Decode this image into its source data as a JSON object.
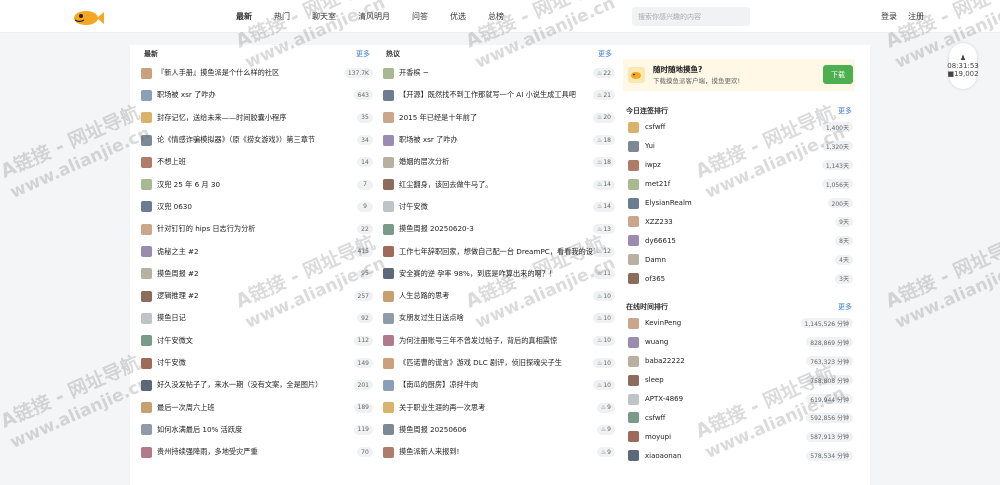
{
  "nav": [
    "最新",
    "热门",
    "聊天室",
    "清风明月",
    "问答",
    "优选",
    "总榜"
  ],
  "search": {
    "placeholder": "搜索你感兴趣的内容"
  },
  "auth": {
    "login": "登录",
    "register": "注册"
  },
  "latest": {
    "title": "最新",
    "more": "更多",
    "items": [
      {
        "title": "『新人手册』摸鱼派是个什么样的社区",
        "badge": "137.7K"
      },
      {
        "title": "职场被 xsr 了咋办",
        "badge": "643"
      },
      {
        "title": "封存记忆，送给未来——时间胶囊小程序",
        "badge": "35"
      },
      {
        "title": "论《情感诈骗模拟器》（原《捞女游戏》）第三章节",
        "badge": "34"
      },
      {
        "title": "不想上班",
        "badge": "14"
      },
      {
        "title": "汉兜 25 年 6 月 30",
        "badge": "7"
      },
      {
        "title": "汉兜 0630",
        "badge": "9"
      },
      {
        "title": "针对钉钉的 hips 日志行为分析",
        "badge": "22"
      },
      {
        "title": "诡秘之主 #2",
        "badge": "415"
      },
      {
        "title": "摸鱼周报 #2",
        "badge": "95"
      },
      {
        "title": "逻辑推理 #2",
        "badge": "257"
      },
      {
        "title": "摸鱼日记",
        "badge": "92"
      },
      {
        "title": "讨午安微文",
        "badge": "112"
      },
      {
        "title": "讨午安微",
        "badge": "149"
      },
      {
        "title": "好久没发帖子了，来水一期（没有文案，全是图片）",
        "badge": "201"
      },
      {
        "title": "最后一次周六上班",
        "badge": "189"
      },
      {
        "title": "如何水满最后 10% 活跃度",
        "badge": "119"
      },
      {
        "title": "贵州持续强降雨，多地受灾严重",
        "badge": "70"
      }
    ]
  },
  "hot": {
    "title": "热议",
    "more": "更多",
    "items": [
      {
        "title": "开香槟 ~",
        "badge": "22"
      },
      {
        "title": "【开源】既然找不到工作那就写一个 AI 小说生成工具吧",
        "badge": "21"
      },
      {
        "title": "2015 年已经是十年前了",
        "badge": "20"
      },
      {
        "title": "职场被 xsr 了咋办",
        "badge": "18"
      },
      {
        "title": "婚姻的层次分析",
        "badge": "18"
      },
      {
        "title": "红尘翻身，该回去做牛马了。",
        "badge": "14"
      },
      {
        "title": "讨午安微",
        "badge": "14"
      },
      {
        "title": "摸鱼周报 20250620-3",
        "badge": "13"
      },
      {
        "title": "工作七年辞职回家，想做自己配一台 DreamPC，看看我的设计吧",
        "badge": "12"
      },
      {
        "title": "安全赛的逆 孕率 98%，到底是咋算出来的啊？！",
        "badge": "11"
      },
      {
        "title": "人生总路的思考",
        "badge": "10"
      },
      {
        "title": "女朋友过生日送点啥",
        "badge": "10"
      },
      {
        "title": "为何注册账号三年不曾发过帖子，背后的真相震惊",
        "badge": "10"
      },
      {
        "title": "《匹诺曹的谎言》游戏 DLC 剧评，侦旧探魂尖子生",
        "badge": "10"
      },
      {
        "title": "【南瓜的厨房】凉拌牛肉",
        "badge": "10"
      },
      {
        "title": "关于职业生涯的再一次思考",
        "badge": "9"
      },
      {
        "title": "摸鱼周报 20250606",
        "badge": "9"
      },
      {
        "title": "摸鱼派新人来报到!",
        "badge": "9"
      }
    ]
  },
  "ad": {
    "title": "随时随地摸鱼?",
    "desc": "下载摸鱼派客户端，摸鱼更欢!",
    "button": "下载"
  },
  "checkin": {
    "title": "今日连签排行",
    "more": "更多",
    "items": [
      {
        "name": "csfwff",
        "value": "1,400天"
      },
      {
        "name": "Yui",
        "value": "1,320天"
      },
      {
        "name": "iwpz",
        "value": "1,143天"
      },
      {
        "name": "met21f",
        "value": "1,056天"
      },
      {
        "name": "ElysianRealm",
        "value": "200天"
      },
      {
        "name": "XZZ233",
        "value": "9天"
      },
      {
        "name": "dy66615",
        "value": "8天"
      },
      {
        "name": "Damn",
        "value": "4天"
      },
      {
        "name": "of365",
        "value": "3天"
      }
    ]
  },
  "online": {
    "title": "在线时间排行",
    "more": "更多",
    "items": [
      {
        "name": "KevinPeng",
        "value": "1,145,526 分钟"
      },
      {
        "name": "wuang",
        "value": "828,869 分钟"
      },
      {
        "name": "baba22222",
        "value": "763,323 分钟"
      },
      {
        "name": "sleep",
        "value": "758,808 分钟"
      },
      {
        "name": "APTX-4869",
        "value": "619,944 分钟"
      },
      {
        "name": "csfwff",
        "value": "592,856 分钟"
      },
      {
        "name": "moyupi",
        "value": "587,913 分钟"
      },
      {
        "name": "xiaoaonan",
        "value": "578,534 分钟"
      }
    ]
  },
  "clock": {
    "time": "08:31:53",
    "count": "19,002"
  },
  "watermark": {
    "line1": "A链接 - 网址导航",
    "line2": "www.alianjie.cn"
  }
}
